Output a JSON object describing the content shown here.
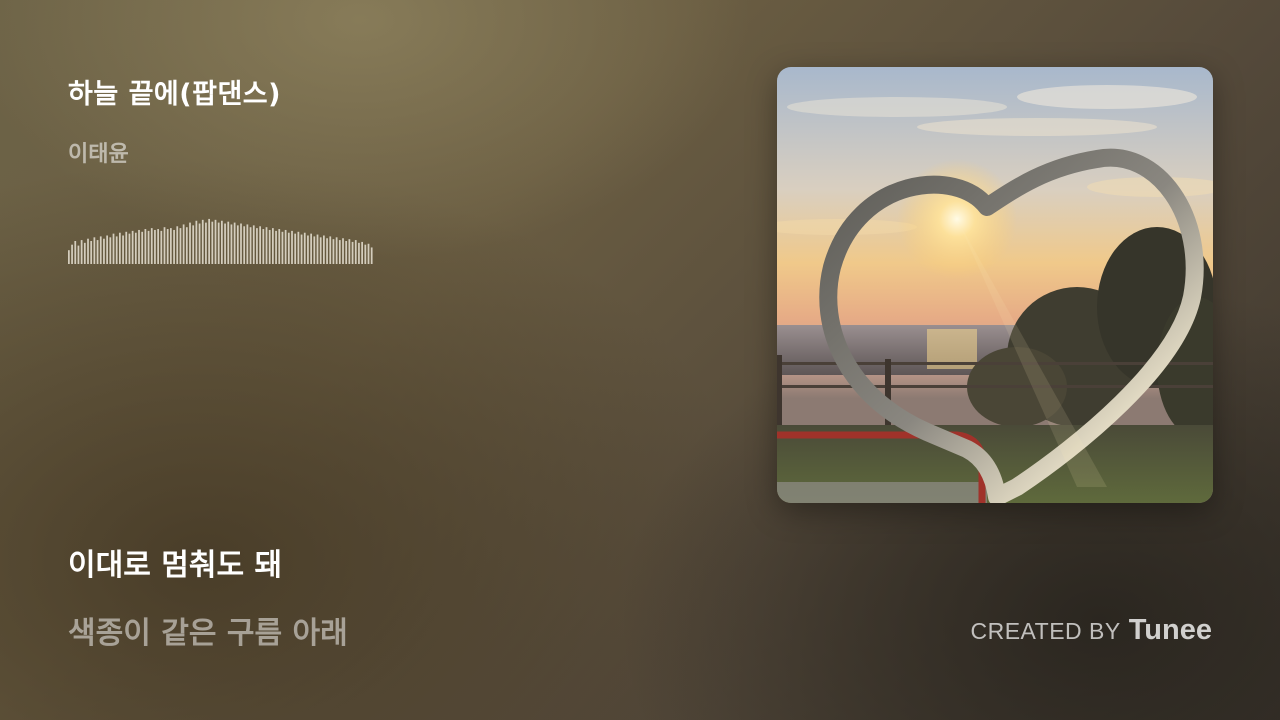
{
  "track": {
    "title": "하늘 끝에(팝댄스)",
    "artist": "이태윤"
  },
  "waveform": {
    "color": "#e8e2d4",
    "levels": [
      0.3,
      0.42,
      0.5,
      0.4,
      0.52,
      0.46,
      0.55,
      0.5,
      0.58,
      0.52,
      0.6,
      0.55,
      0.62,
      0.58,
      0.66,
      0.6,
      0.68,
      0.62,
      0.7,
      0.66,
      0.72,
      0.68,
      0.74,
      0.7,
      0.76,
      0.72,
      0.78,
      0.74,
      0.76,
      0.72,
      0.8,
      0.76,
      0.78,
      0.74,
      0.82,
      0.78,
      0.86,
      0.8,
      0.9,
      0.84,
      0.94,
      0.88,
      0.96,
      0.9,
      0.98,
      0.92,
      0.96,
      0.9,
      0.94,
      0.88,
      0.92,
      0.86,
      0.9,
      0.84,
      0.88,
      0.82,
      0.86,
      0.8,
      0.84,
      0.78,
      0.82,
      0.76,
      0.8,
      0.74,
      0.78,
      0.72,
      0.76,
      0.7,
      0.74,
      0.68,
      0.72,
      0.66,
      0.7,
      0.64,
      0.68,
      0.62,
      0.66,
      0.6,
      0.64,
      0.58,
      0.62,
      0.56,
      0.6,
      0.54,
      0.58,
      0.52,
      0.56,
      0.5,
      0.54,
      0.48,
      0.52,
      0.46,
      0.48,
      0.42,
      0.44,
      0.36
    ]
  },
  "lyrics": {
    "current": "이대로 멈춰도 돼",
    "next": "색종이 같은 구름 아래"
  },
  "credit": {
    "prefix": "CREATED BY",
    "brand": "Tunee"
  },
  "cover": {
    "icon": "album-cover-sunset-heart-sculpture"
  }
}
